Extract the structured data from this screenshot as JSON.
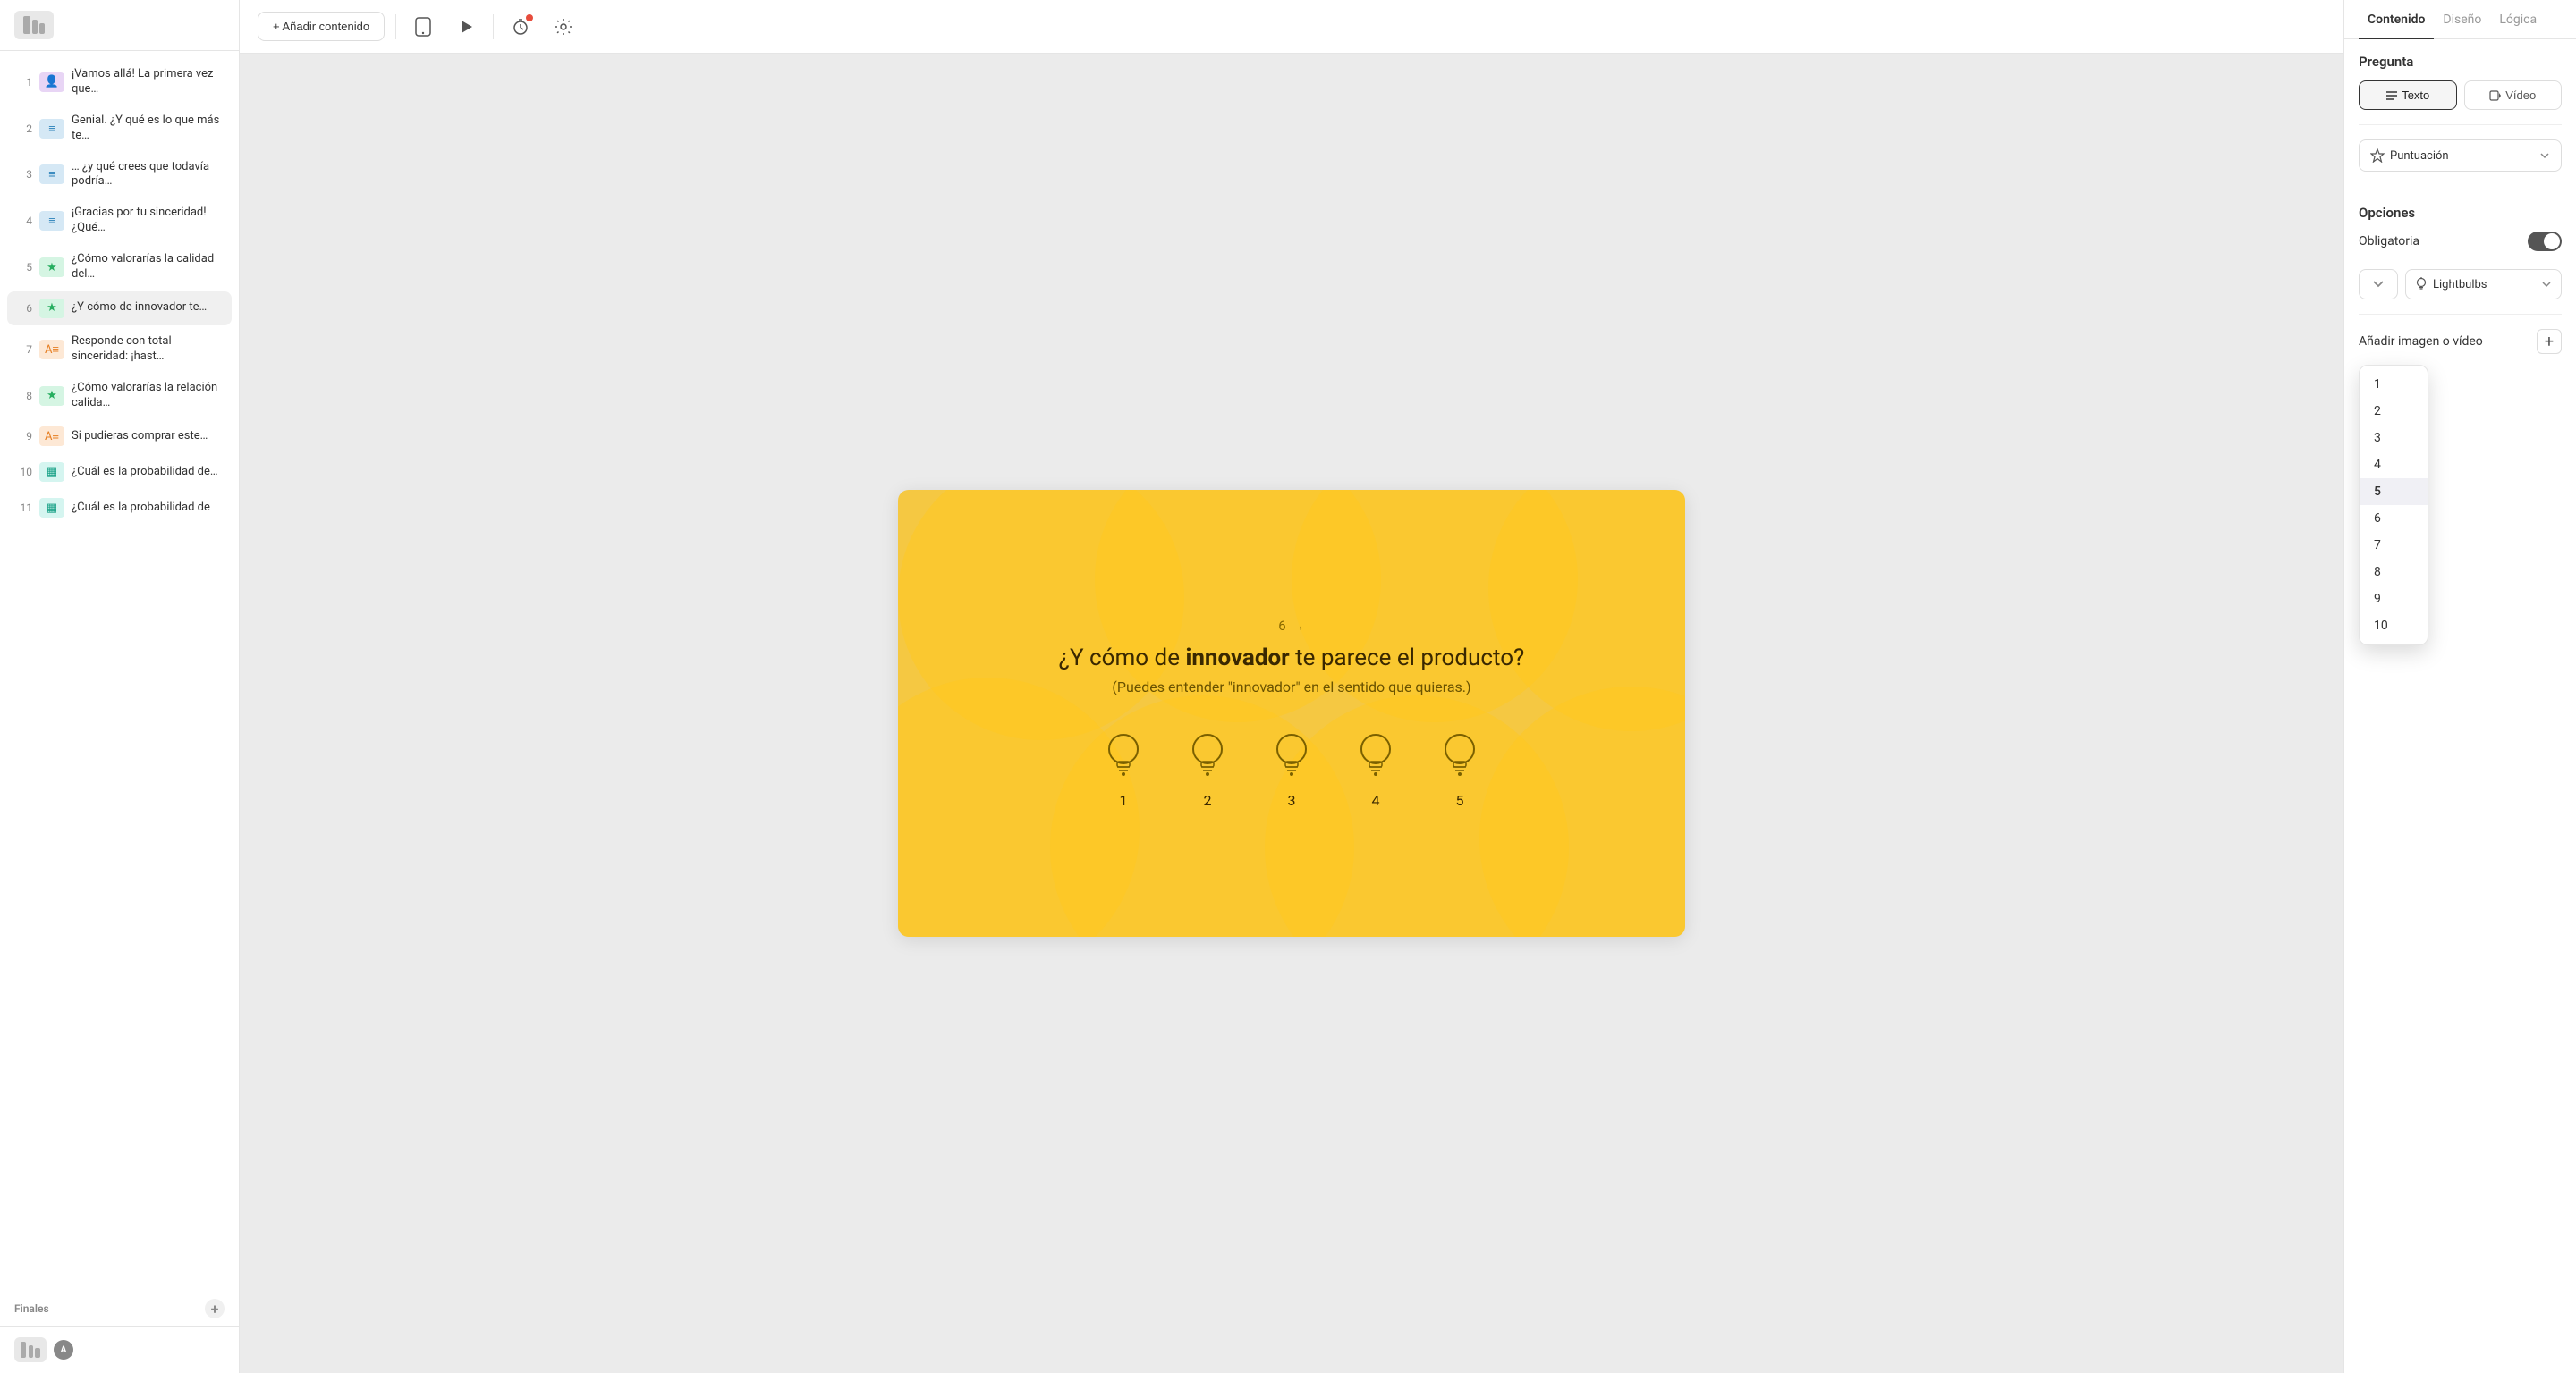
{
  "sidebar": {
    "items": [
      {
        "id": 1,
        "icon_type": "avatar",
        "icon_color": "purple",
        "icon_symbol": "👤",
        "text": "¡Vamos allá! La primera vez que…",
        "num": 1
      },
      {
        "id": 2,
        "icon_type": "text",
        "icon_color": "blue",
        "icon_symbol": "≡",
        "text": "Genial. ¿Y qué es lo que más te…",
        "num": 2
      },
      {
        "id": 3,
        "icon_type": "text",
        "icon_color": "blue",
        "icon_symbol": "≡",
        "text": "… ¿y qué crees que todavía podría…",
        "num": 3
      },
      {
        "id": 4,
        "icon_type": "text",
        "icon_color": "blue",
        "icon_symbol": "≡",
        "text": "¡Gracias por tu sinceridad! ¿Qué…",
        "num": 4
      },
      {
        "id": 5,
        "icon_type": "star",
        "icon_color": "green",
        "icon_symbol": "★",
        "text": "¿Cómo valorarías la calidad del…",
        "num": 5
      },
      {
        "id": 6,
        "icon_type": "star",
        "icon_color": "green",
        "icon_symbol": "★",
        "text": "¿Y cómo de innovador te…",
        "num": 6,
        "active": true
      },
      {
        "id": 7,
        "icon_type": "rank",
        "icon_color": "orange",
        "icon_symbol": "A≡",
        "text": "Responde con total sinceridad: ¡hast…",
        "num": 7
      },
      {
        "id": 8,
        "icon_type": "star",
        "icon_color": "green",
        "icon_symbol": "★",
        "text": "¿Cómo valorarías la relación calida…",
        "num": 8
      },
      {
        "id": 9,
        "icon_type": "rank",
        "icon_color": "orange",
        "icon_symbol": "A≡",
        "text": "Si pudieras comprar este…",
        "num": 9
      },
      {
        "id": 10,
        "icon_type": "bar",
        "icon_color": "teal",
        "icon_symbol": "▦",
        "text": "¿Cuál es la probabilidad de…",
        "num": 10
      },
      {
        "id": 11,
        "icon_type": "bar",
        "icon_color": "teal",
        "icon_symbol": "▦",
        "text": "¿Cuál es la probabilidad de",
        "num": 11
      }
    ],
    "section_label": "Finales",
    "footer_icon": "▦",
    "footer_badge": "A"
  },
  "topbar": {
    "add_label": "+ Añadir contenido",
    "icons": [
      "mobile",
      "play",
      "timer",
      "settings"
    ]
  },
  "slide": {
    "question_number": "6",
    "arrow": "→",
    "question_text_pre": "¿Y cómo de ",
    "question_text_bold": "innovador",
    "question_text_post": " te parece el producto?",
    "question_sub": "(Puedes entender \"innovador\" en el sentido que quieras.)",
    "lightbulbs": [
      {
        "label": "1"
      },
      {
        "label": "2"
      },
      {
        "label": "3"
      },
      {
        "label": "4"
      },
      {
        "label": "5"
      }
    ]
  },
  "right_panel": {
    "tabs": [
      "Contenido",
      "Diseño",
      "Lógica"
    ],
    "active_tab": "Contenido",
    "section_question": "Pregunta",
    "type_text_label": "Texto",
    "type_video_label": "Vídeo",
    "score_label": "Puntuación",
    "options_label": "Opciones",
    "obligatoria_label": "Obligatoria",
    "scale_dropdown_symbol": "∨",
    "lightbulbs_label": "Lightbulbs",
    "add_media_label": "Añadir imagen o vídeo",
    "dropdown_items": [
      "1",
      "2",
      "3",
      "4",
      "5",
      "6",
      "7",
      "8",
      "9",
      "10"
    ],
    "highlighted_item": "5"
  }
}
